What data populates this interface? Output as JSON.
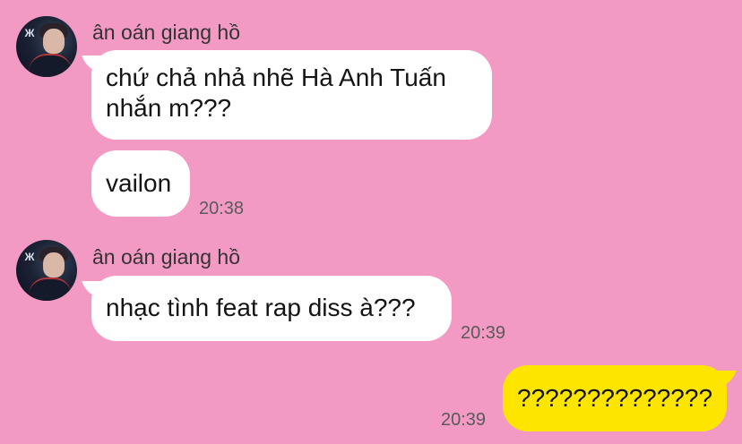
{
  "colors": {
    "background": "#f29ac4",
    "incoming_bubble": "#ffffff",
    "outgoing_bubble": "#fee500"
  },
  "avatar_icon": "profile-photo-icon",
  "messages": [
    {
      "sender": "ân oán giang hồ",
      "lines": [
        "chứ chả nhả nhẽ Hà Anh Tuấn",
        "nhắn m???"
      ]
    },
    {
      "text": "vailon",
      "time": "20:38"
    },
    {
      "sender": "ân oán giang hồ",
      "text": "nhạc tình feat rap diss à???",
      "time": "20:39"
    },
    {
      "text": "??????????????",
      "time": "20:39",
      "outgoing": true
    }
  ]
}
